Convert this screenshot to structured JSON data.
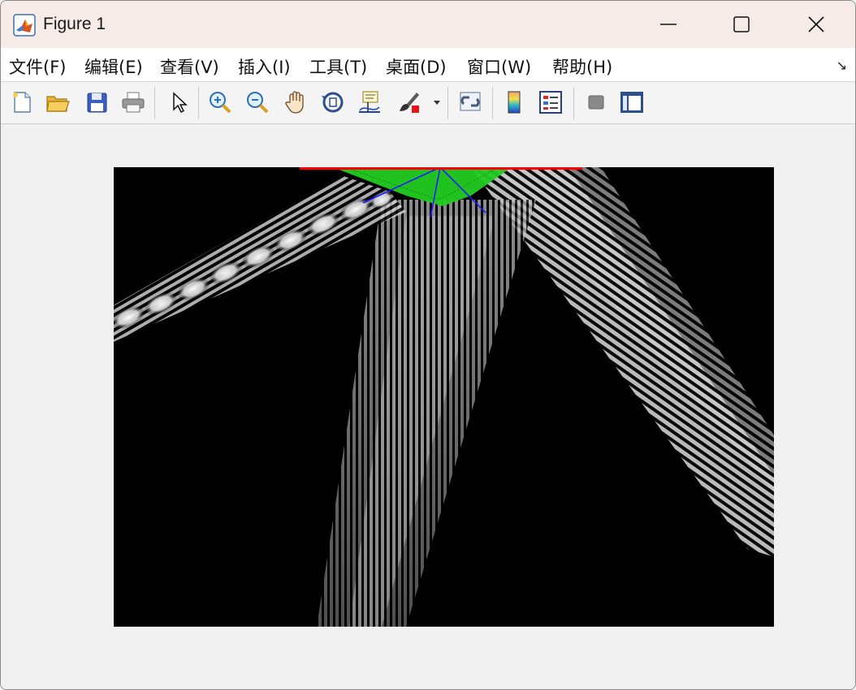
{
  "window": {
    "title": "Figure 1"
  },
  "menu": {
    "items": [
      {
        "label": "文件(F)"
      },
      {
        "label": "编辑(E)"
      },
      {
        "label": "查看(V)"
      },
      {
        "label": "插入(I)"
      },
      {
        "label": "工具(T)"
      },
      {
        "label": "桌面(D)"
      },
      {
        "label": "窗口(W)"
      },
      {
        "label": "帮助(H)"
      }
    ]
  },
  "toolbar": {
    "icons": [
      "new-figure-icon",
      "open-file-icon",
      "save-icon",
      "print-icon",
      "edit-plot-arrow-icon",
      "zoom-in-icon",
      "zoom-out-icon",
      "pan-hand-icon",
      "rotate-3d-icon",
      "data-cursor-icon",
      "brush-icon",
      "brush-dropdown-icon",
      "link-plot-icon",
      "colorbar-icon",
      "legend-icon",
      "hide-plot-tools-icon",
      "show-plot-tools-icon"
    ]
  },
  "colors": {
    "titlebar": "#f7ebe8",
    "transducer": "#ff0000",
    "focal_region": "#22cc22",
    "rays": "#1a1aff",
    "plot_background": "#000000"
  }
}
